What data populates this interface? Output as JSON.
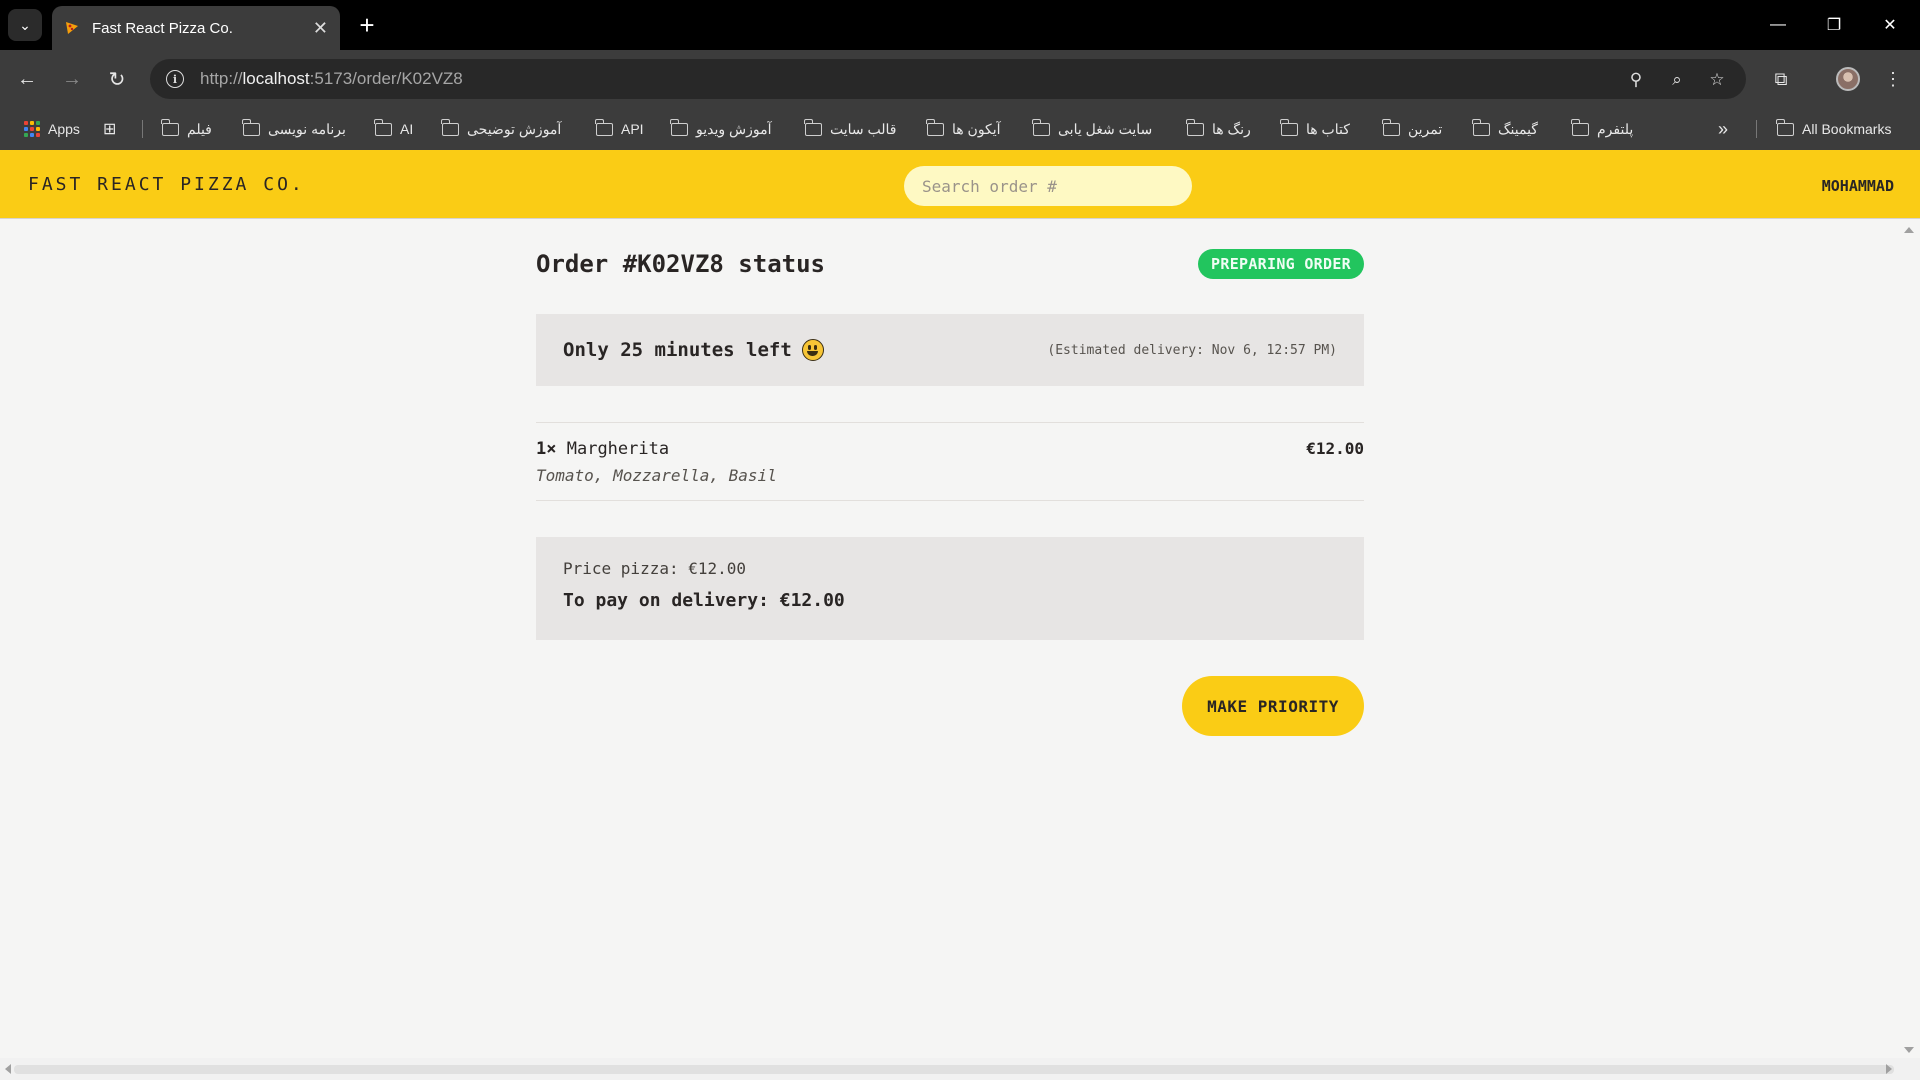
{
  "browser": {
    "tab_title": "Fast React Pizza Co.",
    "url_prefix": "http://",
    "url_host": "localhost",
    "url_path": ":5173/order/K02VZ8",
    "bookmarks": {
      "apps_label": "Apps",
      "items": [
        "فیلم",
        "برنامه نویسی",
        "AI",
        "آموزش توضیحی",
        "API",
        "آموزش ویدیو",
        "قالب سایت",
        "آیکون ها",
        "سایت شغل یابی",
        "رنگ ها",
        "کتاب ها",
        "تمرین",
        "گیمینگ",
        "پلتفرم"
      ],
      "all_bookmarks": "All Bookmarks"
    },
    "icons": {
      "tab_search": "chevron-down-icon",
      "back": "arrow-left-icon",
      "forward": "arrow-right-icon",
      "reload": "reload-icon",
      "site_info": "info-icon",
      "location": "location-pin-icon",
      "zoom": "zoom-icon",
      "star": "star-icon",
      "extensions": "puzzle-icon",
      "menu": "kebab-menu-icon"
    }
  },
  "header": {
    "logo": "FAST REACT PIZZA CO.",
    "search_placeholder": "Search order #",
    "username": "MOHAMMAD"
  },
  "order": {
    "title": "Order #K02VZ8 status",
    "status": "PREPARING ORDER",
    "time_left": "Only 25 minutes left",
    "estimated_delivery": "(Estimated delivery: Nov 6, 12:57 PM)",
    "items": [
      {
        "quantity": "1×",
        "name": "Margherita",
        "price": "€12.00",
        "ingredients": "Tomato, Mozzarella, Basil"
      }
    ],
    "price_pizza": "Price pizza: €12.00",
    "to_pay": "To pay on delivery: €12.00",
    "make_priority": "MAKE PRIORITY"
  },
  "colors": {
    "brand_yellow": "#facc15",
    "status_green": "#22c55e",
    "box_gray": "#e7e5e4"
  }
}
